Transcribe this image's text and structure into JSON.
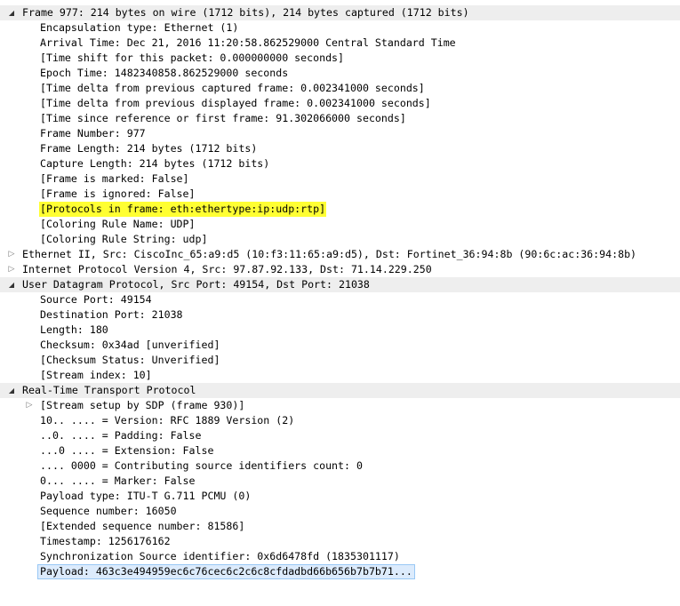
{
  "colors": {
    "highlight": "#ffff33",
    "selection": "#dcebfc",
    "section_bg": "#eeeeee"
  },
  "rows": [
    {
      "text": "Frame 977: 214 bytes on wire (1712 bits), 214 bytes captured (1712 bits)",
      "level": 0,
      "toggle": "expanded",
      "section": true
    },
    {
      "text": "Encapsulation type: Ethernet (1)",
      "level": 1
    },
    {
      "text": "Arrival Time: Dec 21, 2016 11:20:58.862529000 Central Standard Time",
      "level": 1
    },
    {
      "text": "[Time shift for this packet: 0.000000000 seconds]",
      "level": 1
    },
    {
      "text": "Epoch Time: 1482340858.862529000 seconds",
      "level": 1
    },
    {
      "text": "[Time delta from previous captured frame: 0.002341000 seconds]",
      "level": 1
    },
    {
      "text": "[Time delta from previous displayed frame: 0.002341000 seconds]",
      "level": 1
    },
    {
      "text": "[Time since reference or first frame: 91.302066000 seconds]",
      "level": 1
    },
    {
      "text": "Frame Number: 977",
      "level": 1
    },
    {
      "text": "Frame Length: 214 bytes (1712 bits)",
      "level": 1
    },
    {
      "text": "Capture Length: 214 bytes (1712 bits)",
      "level": 1
    },
    {
      "text": "[Frame is marked: False]",
      "level": 1
    },
    {
      "text": "[Frame is ignored: False]",
      "level": 1
    },
    {
      "text": "[Protocols in frame: eth:ethertype:ip:udp:rtp]",
      "level": 1,
      "highlight": true
    },
    {
      "text": "[Coloring Rule Name: UDP]",
      "level": 1
    },
    {
      "text": "[Coloring Rule String: udp]",
      "level": 1
    },
    {
      "text": "Ethernet II, Src: CiscoInc_65:a9:d5 (10:f3:11:65:a9:d5), Dst: Fortinet_36:94:8b (90:6c:ac:36:94:8b)",
      "level": 0,
      "toggle": "collapsed"
    },
    {
      "text": "Internet Protocol Version 4, Src: 97.87.92.133, Dst: 71.14.229.250",
      "level": 0,
      "toggle": "collapsed"
    },
    {
      "text": "User Datagram Protocol, Src Port: 49154, Dst Port: 21038",
      "level": 0,
      "toggle": "expanded",
      "section": true
    },
    {
      "text": "Source Port: 49154",
      "level": 1
    },
    {
      "text": "Destination Port: 21038",
      "level": 1
    },
    {
      "text": "Length: 180",
      "level": 1
    },
    {
      "text": "Checksum: 0x34ad [unverified]",
      "level": 1
    },
    {
      "text": "[Checksum Status: Unverified]",
      "level": 1
    },
    {
      "text": "[Stream index: 10]",
      "level": 1
    },
    {
      "text": "Real-Time Transport Protocol",
      "level": 0,
      "toggle": "expanded",
      "section": true
    },
    {
      "text": "[Stream setup by SDP (frame 930)]",
      "level": 1,
      "toggle": "collapsed"
    },
    {
      "text": "10.. .... = Version: RFC 1889 Version (2)",
      "level": 1
    },
    {
      "text": "..0. .... = Padding: False",
      "level": 1
    },
    {
      "text": "...0 .... = Extension: False",
      "level": 1
    },
    {
      "text": ".... 0000 = Contributing source identifiers count: 0",
      "level": 1
    },
    {
      "text": "0... .... = Marker: False",
      "level": 1
    },
    {
      "text": "Payload type: ITU-T G.711 PCMU (0)",
      "level": 1
    },
    {
      "text": "Sequence number: 16050",
      "level": 1
    },
    {
      "text": "[Extended sequence number: 81586]",
      "level": 1
    },
    {
      "text": "Timestamp: 1256176162",
      "level": 1
    },
    {
      "text": "Synchronization Source identifier: 0x6d6478fd (1835301117)",
      "level": 1
    },
    {
      "text": "Payload: 463c3e494959ec6c76cec6c2c6c8cfdadbd66b656b7b7b71...",
      "level": 1,
      "selected": true
    }
  ]
}
